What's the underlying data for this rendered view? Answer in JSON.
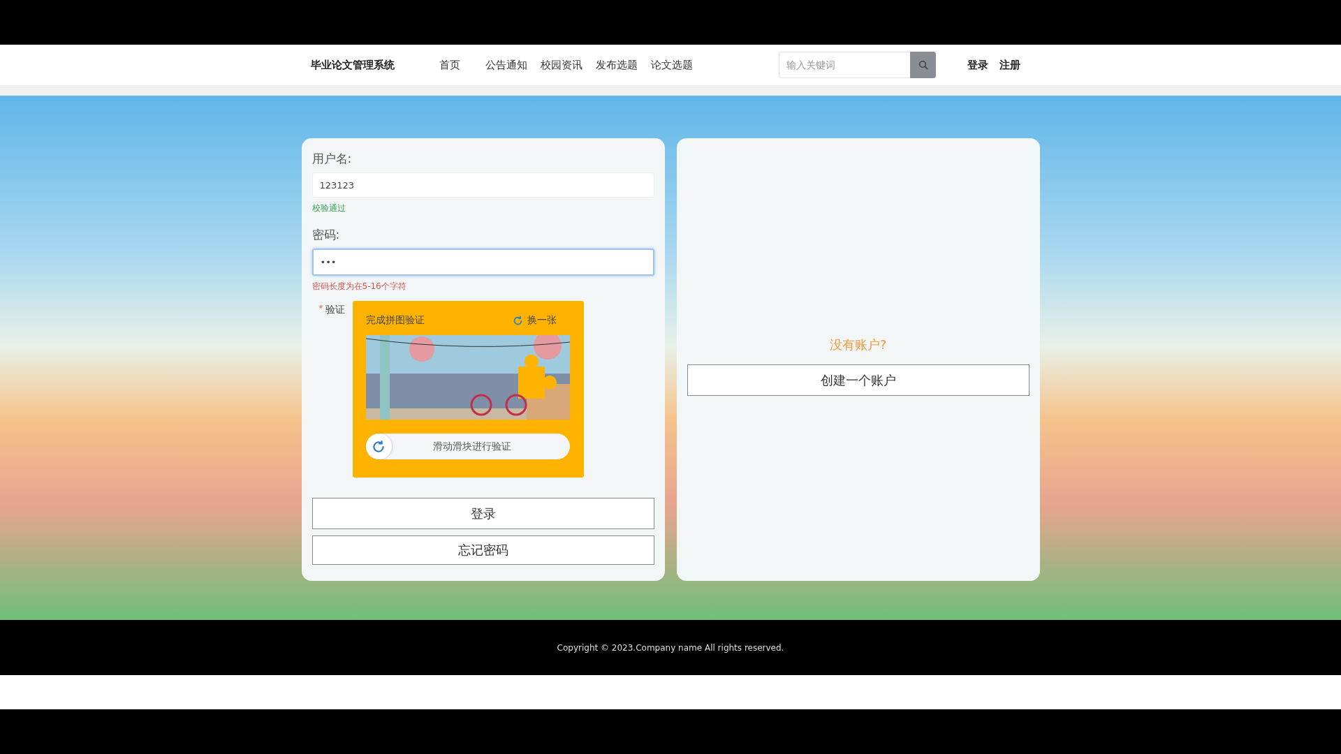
{
  "top_bar": {
    "brand": "毕业论文管理系统",
    "nav": [
      "首页",
      "公告通知",
      "校园资讯",
      "发布选题",
      "论文选题"
    ],
    "search": {
      "placeholder": "输入关键词"
    },
    "auth_links": [
      "登录",
      "注册"
    ]
  },
  "login_form": {
    "username": {
      "label": "用户名:",
      "value": "123123",
      "focused": false,
      "message": "校验通过",
      "valid": true
    },
    "password": {
      "label": "密码:",
      "value": "•••",
      "focused": true,
      "message": "密码长度为在5-16个字符",
      "valid": false
    },
    "captcha": {
      "label": "验证",
      "required_mark": "*",
      "title": "完成拼图验证",
      "refresh": "换一张",
      "slider_hint": "滑动滑块进行验证"
    },
    "buttons": [
      "登录",
      "忘记密码"
    ]
  },
  "register_panel": {
    "prompt": "没有账户?",
    "button": "创建一个账户"
  },
  "footer": {
    "copyright": "Copyright © 2023.Company name All rights reserved."
  }
}
